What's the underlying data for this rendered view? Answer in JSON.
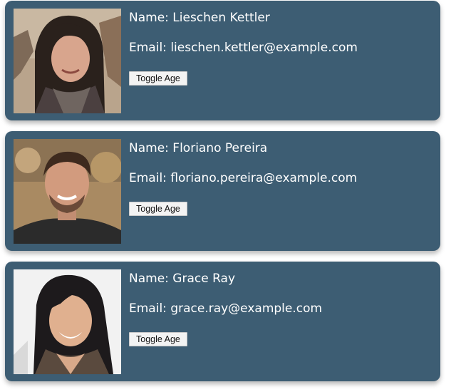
{
  "users": [
    {
      "name_prefix": "Name:",
      "name": "Lieschen Kettler",
      "email_prefix": "Email:",
      "email": "lieschen.kettler@example.com",
      "toggle_label": "Toggle Age"
    },
    {
      "name_prefix": "Name:",
      "name": "Floriano Pereira",
      "email_prefix": "Email:",
      "email": "floriano.pereira@example.com",
      "toggle_label": "Toggle Age"
    },
    {
      "name_prefix": "Name:",
      "name": "Grace Ray",
      "email_prefix": "Email:",
      "email": "grace.ray@example.com",
      "toggle_label": "Toggle Age"
    }
  ],
  "colors": {
    "card_background": "#3d5d73",
    "card_text": "#ffffff",
    "button_background": "#f3f3f3"
  }
}
